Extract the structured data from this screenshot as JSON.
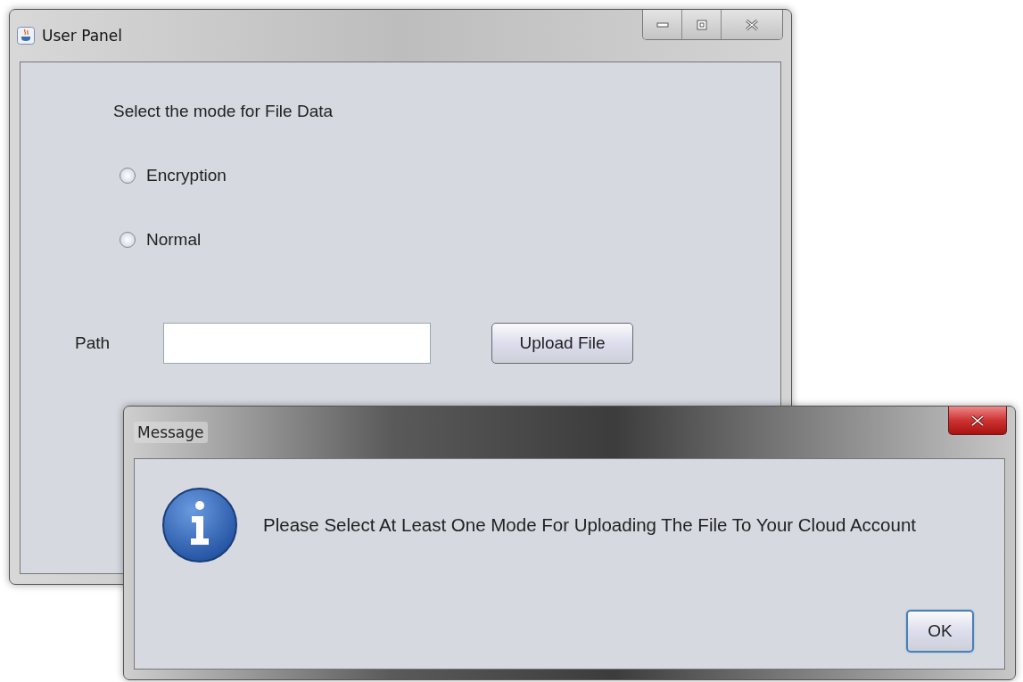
{
  "main_window": {
    "title": "User Panel",
    "prompt": "Select the mode for File Data",
    "modes": [
      {
        "label": "Encryption",
        "selected": false
      },
      {
        "label": "Normal",
        "selected": false
      }
    ],
    "path": {
      "label": "Path"
    },
    "upload_button": "Upload File"
  },
  "dialog": {
    "title": "Message",
    "message": "Please Select At Least One Mode For Uploading The File To Your Cloud Account",
    "ok_button": "OK"
  }
}
